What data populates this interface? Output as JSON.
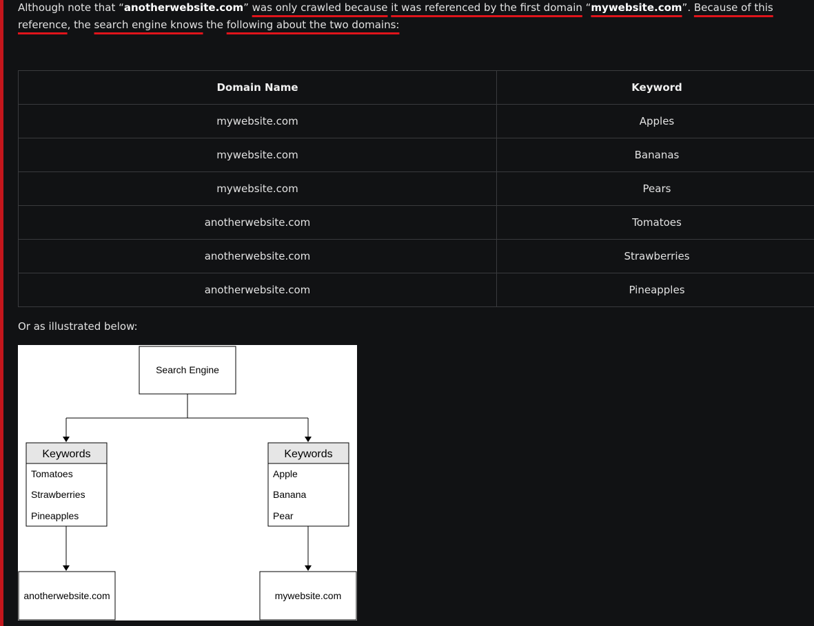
{
  "intro": {
    "p1": "Although note that “",
    "domain_a": "anotherwebsite.com",
    "p2": "” ",
    "u1": "was only crawled because",
    "p3": " ",
    "u2": "it was referenced by the first domain",
    "p4": " “",
    "domain_b": "mywebsite.com",
    "p5": "”. ",
    "u3": "Because of this reference",
    "p6": ", the ",
    "u4": "search engine knows",
    "p7": " the ",
    "u5": "following about the two domains:"
  },
  "table": {
    "headers": [
      "Domain Name",
      "Keyword"
    ],
    "rows": [
      [
        "mywebsite.com",
        "Apples"
      ],
      [
        "mywebsite.com",
        "Bananas"
      ],
      [
        "mywebsite.com",
        "Pears"
      ],
      [
        "anotherwebsite.com",
        "Tomatoes"
      ],
      [
        "anotherwebsite.com",
        "Strawberries"
      ],
      [
        "anotherwebsite.com",
        "Pineapples"
      ]
    ]
  },
  "caption": "Or as illustrated below:",
  "diagram": {
    "root": "Search Engine",
    "left": {
      "header": "Keywords",
      "items": [
        "Tomatoes",
        "Strawberries",
        "Pineapples"
      ],
      "domain": "anotherwebsite.com"
    },
    "right": {
      "header": "Keywords",
      "items": [
        "Apple",
        "Banana",
        "Pear"
      ],
      "domain": "mywebsite.com"
    }
  }
}
